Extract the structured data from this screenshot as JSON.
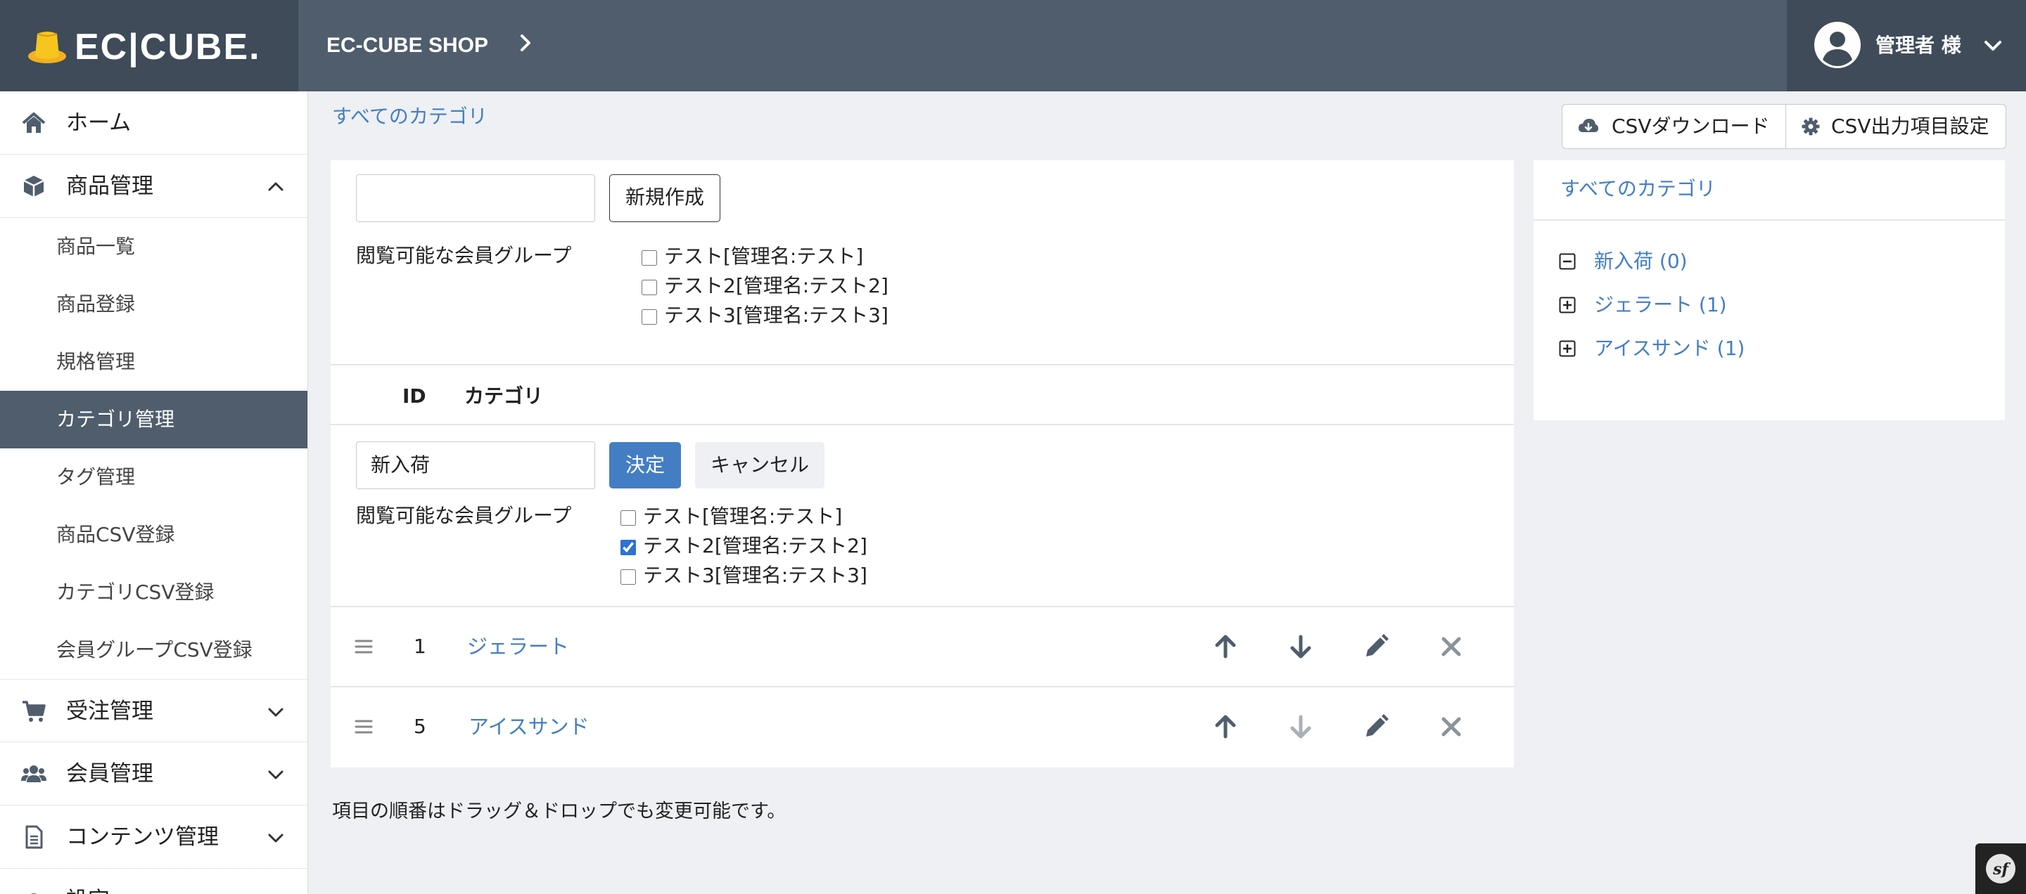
{
  "header": {
    "logo_text": "EC|CUBE.",
    "shop_name": "EC-CUBE SHOP",
    "user_name": "管理者 様"
  },
  "sidebar": {
    "items": [
      {
        "label": "ホーム",
        "icon": "home-icon"
      },
      {
        "label": "商品管理",
        "icon": "cube-icon",
        "expanded": true
      },
      {
        "label": "受注管理",
        "icon": "cart-icon"
      },
      {
        "label": "会員管理",
        "icon": "users-icon"
      },
      {
        "label": "コンテンツ管理",
        "icon": "file-icon"
      },
      {
        "label": "設定",
        "icon": "gear-icon"
      }
    ],
    "sub_items": [
      {
        "label": "商品一覧"
      },
      {
        "label": "商品登録"
      },
      {
        "label": "規格管理"
      },
      {
        "label": "カテゴリ管理",
        "active": true
      },
      {
        "label": "タグ管理"
      },
      {
        "label": "商品CSV登録"
      },
      {
        "label": "カテゴリCSV登録"
      },
      {
        "label": "会員グループCSV登録"
      }
    ]
  },
  "main": {
    "breadcrumb": "すべてのカテゴリ",
    "csv_download_label": "CSVダウンロード",
    "csv_settings_label": "CSV出力項目設定",
    "new_form": {
      "name_value": "",
      "create_label": "新規作成",
      "group_label": "閲覧可能な会員グループ",
      "groups": [
        {
          "label": "テスト[管理名:テスト]",
          "checked": false
        },
        {
          "label": "テスト2[管理名:テスト2]",
          "checked": false
        },
        {
          "label": "テスト3[管理名:テスト3]",
          "checked": false
        }
      ]
    },
    "table": {
      "col_id": "ID",
      "col_category": "カテゴリ"
    },
    "edit_form": {
      "name_value": "新入荷",
      "submit_label": "決定",
      "cancel_label": "キャンセル",
      "group_label": "閲覧可能な会員グループ",
      "groups": [
        {
          "label": "テスト[管理名:テスト]",
          "checked": false
        },
        {
          "label": "テスト2[管理名:テスト2]",
          "checked": true
        },
        {
          "label": "テスト3[管理名:テスト3]",
          "checked": false
        }
      ]
    },
    "rows": [
      {
        "id": "1",
        "name": "ジェラート",
        "down_enabled": true
      },
      {
        "id": "5",
        "name": "アイスサンド",
        "down_enabled": false
      }
    ],
    "note": "項目の順番はドラッグ＆ドロップでも変更可能です。"
  },
  "tree": {
    "title": "すべてのカテゴリ",
    "items": [
      {
        "label": "新入荷 (0)",
        "state": "collapse"
      },
      {
        "label": "ジェラート (1)",
        "state": "expand"
      },
      {
        "label": "アイスサンド (1)",
        "state": "expand"
      }
    ]
  },
  "colors": {
    "header_bg": "#4f5d6d",
    "header_dark": "#3f4b59",
    "link": "#437ec4",
    "primary": "#437ec4",
    "page_bg": "#eef0f3"
  }
}
